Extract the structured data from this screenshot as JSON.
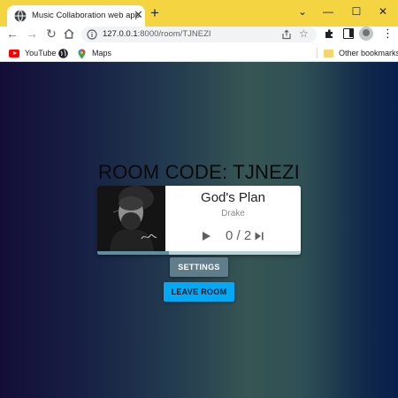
{
  "browser": {
    "tab_title": "Music Collaboration web app",
    "url_host": "127.0.0.1",
    "url_path": ":8000/room/TJNEZI",
    "bookmarks": [
      {
        "label": "YouTube",
        "icon": "youtube-icon"
      },
      {
        "label": "",
        "icon": "globe-icon"
      },
      {
        "label": "Maps",
        "icon": "maps-icon"
      }
    ],
    "other_bookmarks": "Other bookmarks",
    "theme_color": "#f5d441"
  },
  "room": {
    "code_label": "ROOM CODE:",
    "code": "TJNEZI"
  },
  "player": {
    "title": "God's Plan",
    "artist": "Drake",
    "votes": "0 / 2",
    "progress": 0.35,
    "progress_color": "#5d8fa0",
    "track_color": "#b9d4d9"
  },
  "buttons": {
    "settings": "SETTINGS",
    "leave": "LEAVE ROOM",
    "settings_color": "#607d8b",
    "leave_color": "#03a9f4"
  }
}
